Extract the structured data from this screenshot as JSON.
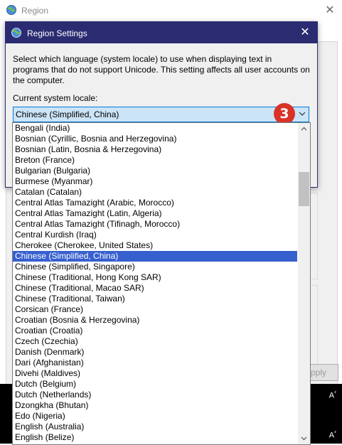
{
  "background_window": {
    "title": "Region",
    "apply_label": "Apply"
  },
  "taskbar": {
    "icon_glyph": "A"
  },
  "dialog": {
    "title": "Region Settings",
    "description": "Select which language (system locale) to use when displaying text in programs that do not support Unicode. This setting affects all user accounts on the computer.",
    "locale_label": "Current system locale:",
    "selected_locale": "Chinese (Simplified, China)"
  },
  "step_badge": "3",
  "dropdown": {
    "scroll_position": 0.14,
    "items": [
      {
        "label": "Bengali (India)",
        "selected": false
      },
      {
        "label": "Bosnian (Cyrillic, Bosnia and Herzegovina)",
        "selected": false
      },
      {
        "label": "Bosnian (Latin, Bosnia & Herzegovina)",
        "selected": false
      },
      {
        "label": "Breton (France)",
        "selected": false
      },
      {
        "label": "Bulgarian (Bulgaria)",
        "selected": false
      },
      {
        "label": "Burmese (Myanmar)",
        "selected": false
      },
      {
        "label": "Catalan (Catalan)",
        "selected": false
      },
      {
        "label": "Central Atlas Tamazight (Arabic, Morocco)",
        "selected": false
      },
      {
        "label": "Central Atlas Tamazight (Latin, Algeria)",
        "selected": false
      },
      {
        "label": "Central Atlas Tamazight (Tifinagh, Morocco)",
        "selected": false
      },
      {
        "label": "Central Kurdish (Iraq)",
        "selected": false
      },
      {
        "label": "Cherokee (Cherokee, United States)",
        "selected": false
      },
      {
        "label": "Chinese (Simplified, China)",
        "selected": true
      },
      {
        "label": "Chinese (Simplified, Singapore)",
        "selected": false
      },
      {
        "label": "Chinese (Traditional, Hong Kong SAR)",
        "selected": false
      },
      {
        "label": "Chinese (Traditional, Macao SAR)",
        "selected": false
      },
      {
        "label": "Chinese (Traditional, Taiwan)",
        "selected": false
      },
      {
        "label": "Corsican (France)",
        "selected": false
      },
      {
        "label": "Croatian (Bosnia & Herzegovina)",
        "selected": false
      },
      {
        "label": "Croatian (Croatia)",
        "selected": false
      },
      {
        "label": "Czech (Czechia)",
        "selected": false
      },
      {
        "label": "Danish (Denmark)",
        "selected": false
      },
      {
        "label": "Dari (Afghanistan)",
        "selected": false
      },
      {
        "label": "Divehi (Maldives)",
        "selected": false
      },
      {
        "label": "Dutch (Belgium)",
        "selected": false
      },
      {
        "label": "Dutch (Netherlands)",
        "selected": false
      },
      {
        "label": "Dzongkha (Bhutan)",
        "selected": false
      },
      {
        "label": "Edo (Nigeria)",
        "selected": false
      },
      {
        "label": "English (Australia)",
        "selected": false
      },
      {
        "label": "English (Belize)",
        "selected": false
      }
    ]
  },
  "colors": {
    "dialog_titlebar": "#2b2b72",
    "selection": "#3760cf",
    "combo_highlight": "#cce4f7",
    "badge": "#d93226"
  }
}
